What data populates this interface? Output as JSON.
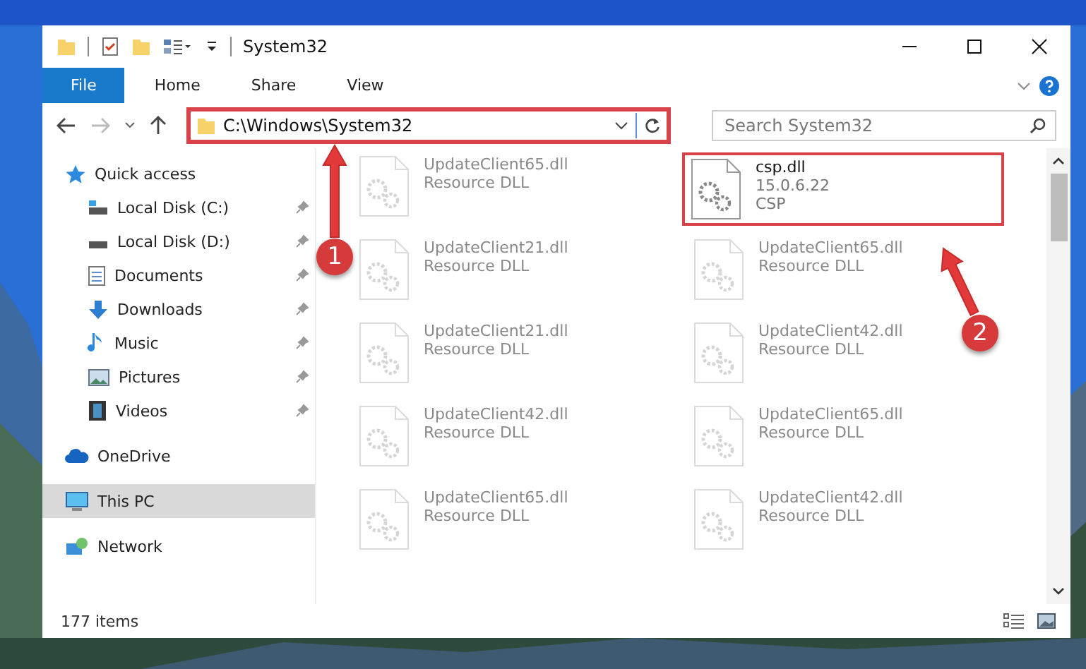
{
  "window": {
    "title": "System32"
  },
  "ribbon_tabs": [
    {
      "label": "File",
      "selected": true
    },
    {
      "label": "Home",
      "selected": false
    },
    {
      "label": "Share",
      "selected": false
    },
    {
      "label": "View",
      "selected": false
    }
  ],
  "address": {
    "path": "C:\\Windows\\System32",
    "highlighted": true
  },
  "search": {
    "placeholder": "Search System32"
  },
  "nav": [
    {
      "label": "Quick access",
      "selected": false,
      "children": [
        {
          "label": "Local Disk (C:)",
          "pinned": true
        },
        {
          "label": "Local Disk (D:)",
          "pinned": true
        },
        {
          "label": "Documents",
          "pinned": true
        },
        {
          "label": "Downloads",
          "pinned": true
        },
        {
          "label": "Music",
          "pinned": true
        },
        {
          "label": "Pictures",
          "pinned": true
        },
        {
          "label": "Videos",
          "pinned": true
        }
      ]
    },
    {
      "label": "OneDrive",
      "selected": false
    },
    {
      "label": "This PC",
      "selected": true
    },
    {
      "label": "Network",
      "selected": false
    }
  ],
  "files": [
    {
      "name": "UpdateClient65.dll",
      "details": [
        "Resource DLL"
      ],
      "faded": true,
      "highlighted": false
    },
    {
      "name": "csp.dll",
      "details": [
        "15.0.6.22",
        "CSP"
      ],
      "faded": false,
      "highlighted": true
    },
    {
      "name": "UpdateClient21.dll",
      "details": [
        "Resource DLL"
      ],
      "faded": true,
      "highlighted": false
    },
    {
      "name": "UpdateClient65.dll",
      "details": [
        "Resource DLL"
      ],
      "faded": true,
      "highlighted": false
    },
    {
      "name": "UpdateClient21.dll",
      "details": [
        "Resource DLL"
      ],
      "faded": true,
      "highlighted": false
    },
    {
      "name": "UpdateClient42.dll",
      "details": [
        "Resource DLL"
      ],
      "faded": true,
      "highlighted": false
    },
    {
      "name": "UpdateClient42.dll",
      "details": [
        "Resource DLL"
      ],
      "faded": true,
      "highlighted": false
    },
    {
      "name": "UpdateClient65.dll",
      "details": [
        "Resource DLL"
      ],
      "faded": true,
      "highlighted": false
    },
    {
      "name": "UpdateClient65.dll",
      "details": [
        "Resource DLL"
      ],
      "faded": true,
      "highlighted": false
    },
    {
      "name": "UpdateClient42.dll",
      "details": [
        "Resource DLL"
      ],
      "faded": true,
      "highlighted": false
    }
  ],
  "status_bar": {
    "item_count": "177 items"
  },
  "annotations": [
    {
      "label": "1"
    },
    {
      "label": "2"
    }
  ]
}
